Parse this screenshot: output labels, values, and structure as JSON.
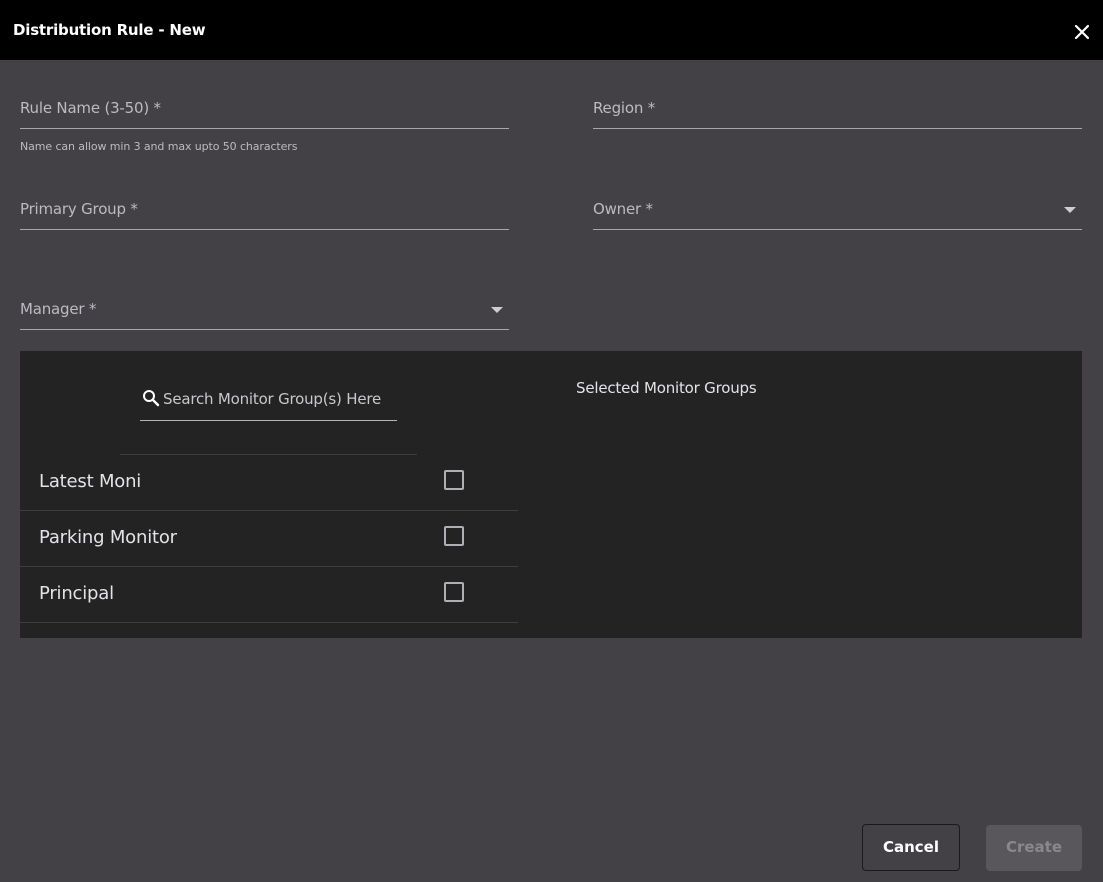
{
  "dialog": {
    "title": "Distribution Rule - New"
  },
  "form": {
    "rule_name_label": "Rule Name (3-50) *",
    "rule_name_hint": "Name can allow min 3 and max upto 50 characters",
    "region_label": "Region *",
    "primary_group_label": "Primary Group *",
    "owner_label": "Owner *",
    "manager_label": "Manager *"
  },
  "monitor_groups": {
    "search_placeholder": "Search Monitor Group(s) Here",
    "selected_title": "Selected Monitor Groups",
    "items": [
      {
        "label": "Latest Moni",
        "checked": false
      },
      {
        "label": "Parking Monitor",
        "checked": false
      },
      {
        "label": "Principal",
        "checked": false
      }
    ]
  },
  "actions": {
    "cancel_label": "Cancel",
    "create_label": "Create"
  },
  "colors": {
    "background": "#434046",
    "titlebar": "#000000",
    "panel": "#232323",
    "disabled_button": "#59575c"
  },
  "icons": {
    "close": "close-icon",
    "search": "search-icon",
    "dropdown": "caret-down-icon"
  }
}
